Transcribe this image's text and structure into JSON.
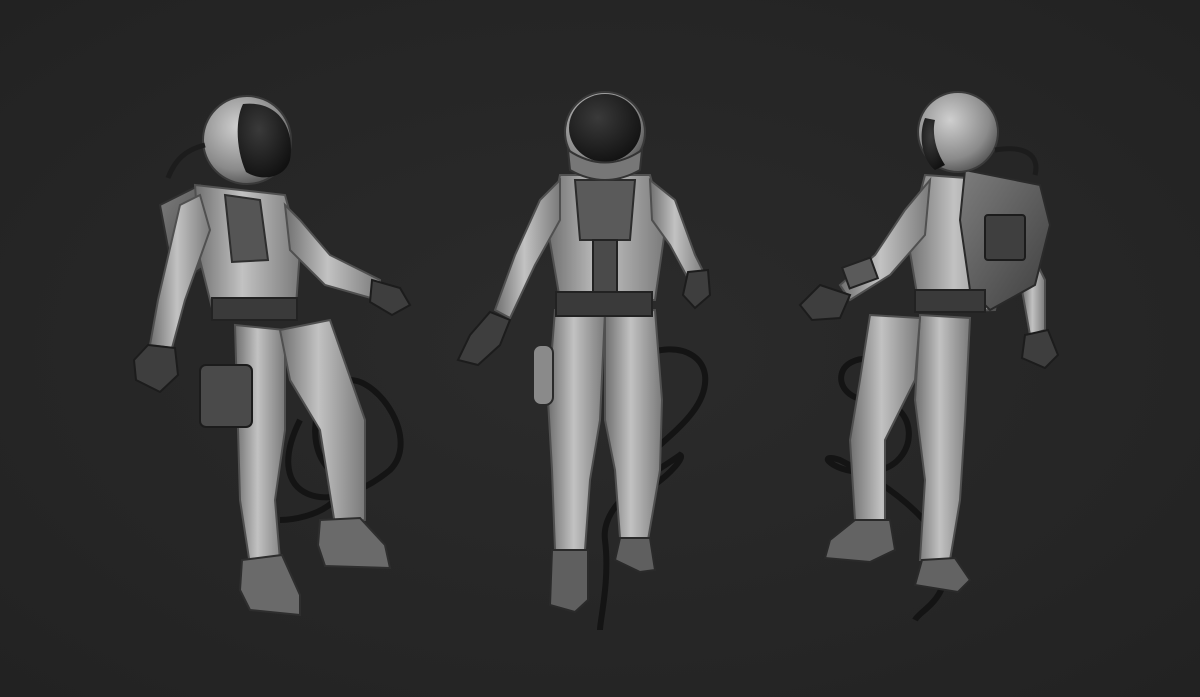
{
  "scene": {
    "background": "#262626",
    "suit_light": "#b9b9b9",
    "suit_mid": "#8e8e8e",
    "suit_dark": "#4a4a4a",
    "visor": "#1c1c1c",
    "hose": "#141414"
  },
  "figures": [
    {
      "view": "three-quarter-left"
    },
    {
      "view": "front"
    },
    {
      "view": "back-three-quarter-right"
    }
  ]
}
